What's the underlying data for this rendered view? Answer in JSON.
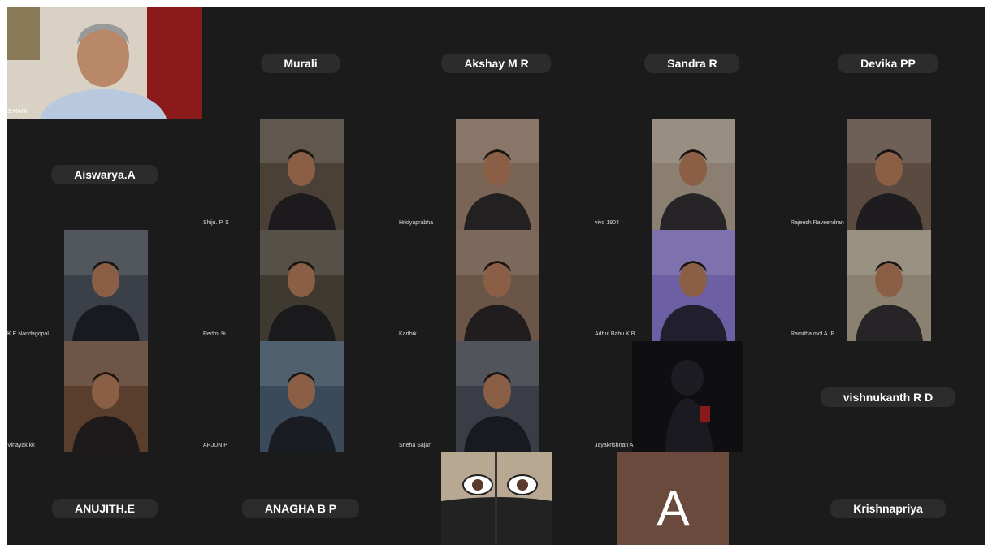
{
  "participants": [
    {
      "name": "S.MANI",
      "display": "full",
      "bg": "#8a7a68"
    },
    {
      "name": "Murali",
      "display": "pill"
    },
    {
      "name": "Akshay M R",
      "display": "pill"
    },
    {
      "name": "Sandra R",
      "display": "pill"
    },
    {
      "name": "Devika PP",
      "display": "pill"
    },
    {
      "name": "Aiswarya.A",
      "display": "pill"
    },
    {
      "name": "Shiju. P. S",
      "display": "video",
      "bg": "#4a4036"
    },
    {
      "name": "Hridyaprabha",
      "display": "video",
      "bg": "#7a6455"
    },
    {
      "name": "vivo 1904",
      "display": "video",
      "bg": "#8a7f70"
    },
    {
      "name": "Rajeesh Raveendran",
      "display": "video",
      "bg": "#5a4a40"
    },
    {
      "name": "K E Nandagopal",
      "display": "video",
      "bg": "#3b4048"
    },
    {
      "name": "Redmi 9i",
      "display": "video",
      "bg": "#3e3a30"
    },
    {
      "name": "Karthik",
      "display": "video",
      "bg": "#6a5546"
    },
    {
      "name": "Adhul Babu K B",
      "display": "video",
      "bg": "#6d5fa3"
    },
    {
      "name": "Ramitha mol A. P",
      "display": "video",
      "bg": "#8a8170"
    },
    {
      "name": "Vinayak kk",
      "display": "video",
      "bg": "#5a3e2d"
    },
    {
      "name": "ARJUN P",
      "display": "video",
      "bg": "#3a4a5a"
    },
    {
      "name": "Sneha Sajan",
      "display": "video",
      "bg": "#3a3d45"
    },
    {
      "name": "Jayakrishnan A",
      "display": "video-wide",
      "bg": "#0f0f12"
    },
    {
      "name": "vishnukanth R D",
      "display": "pill"
    },
    {
      "name": "ANUJITH.E",
      "display": "pill"
    },
    {
      "name": "ANAGHA B P",
      "display": "pill"
    },
    {
      "name": "",
      "display": "cartoon",
      "bg": "#5a5248"
    },
    {
      "name": "A",
      "display": "avatar",
      "bg": "#6b4a3e"
    },
    {
      "name": "Krishnapriya",
      "display": "pill"
    }
  ],
  "colors": {
    "background": "#1b1b1b",
    "pill": "#2c2c2c",
    "text": "#ffffff"
  }
}
